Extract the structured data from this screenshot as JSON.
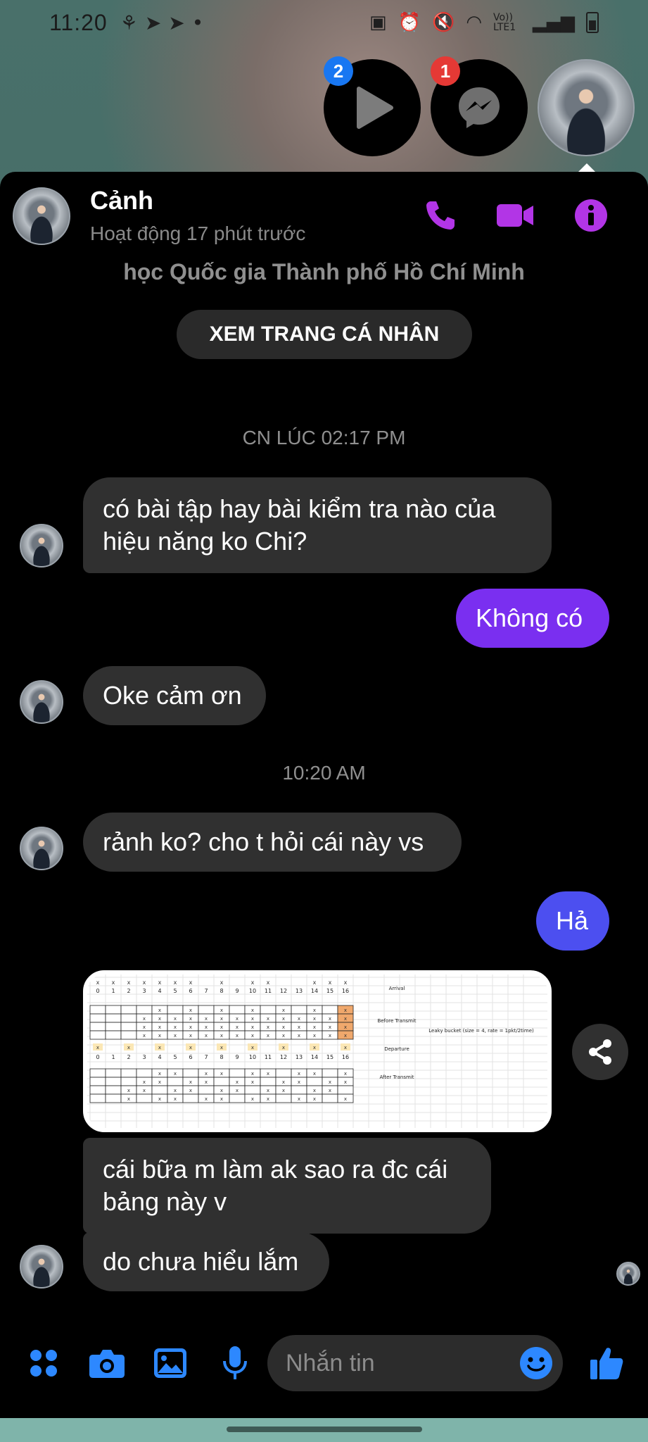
{
  "status_bar": {
    "time": "11:20",
    "network": "Vo)) LTE1",
    "left_icons": [
      "notification-icon",
      "navigation-icon",
      "navigation-icon",
      "dot-icon"
    ],
    "right_icons": [
      "photo-icon",
      "alarm-icon",
      "mute-icon",
      "wifi-icon",
      "signal-icon",
      "battery-icon"
    ]
  },
  "chat_heads": [
    {
      "icon": "play-icon",
      "badge": "2",
      "badge_color": "#1877f2"
    },
    {
      "icon": "messenger-icon",
      "badge": "1",
      "badge_color": "#e53935"
    },
    {
      "icon": "avatar",
      "badge": ""
    }
  ],
  "header": {
    "name": "Cảnh",
    "status": "Hoạt động 17 phút trước",
    "accent": "#b235e6"
  },
  "profile": {
    "subtitle": "học Quốc gia Thành phố Hồ Chí Minh",
    "button_label": "XEM TRANG CÁ NHÂN"
  },
  "messages": {
    "timestamp_1": "CN LÚC 02:17 PM",
    "m1_line1": "có bài tập hay bài kiểm tra nào của",
    "m1_line2": "hiệu năng ko Chi?",
    "m2": "Không có",
    "m3": "Oke cảm ơn",
    "timestamp_2": "10:20 AM",
    "m4": "rảnh ko? cho t hỏi cái này vs",
    "m5": "Hả",
    "m7_line1": "cái bữa m làm ak sao ra đc cái",
    "m7_line2": "bảng này v",
    "m8": "do chưa hiểu lắm"
  },
  "image_table": {
    "columns": [
      "0",
      "1",
      "2",
      "3",
      "4",
      "5",
      "6",
      "7",
      "8",
      "9",
      "10",
      "11",
      "12",
      "13",
      "14",
      "15",
      "16"
    ],
    "labels": {
      "arrival": "Arrival",
      "before": "Before Transmit",
      "departure": "Departure",
      "after": "After Transmit",
      "note": "Leaky bucket (size = 4, rate = 1pkt/2time)"
    },
    "arrival_marks": [
      1,
      1,
      1,
      1,
      1,
      1,
      1,
      0,
      1,
      0,
      1,
      1,
      0,
      0,
      1,
      1,
      1
    ],
    "departure_marks": [
      1,
      0,
      1,
      0,
      1,
      0,
      1,
      0,
      1,
      0,
      1,
      0,
      1,
      0,
      1,
      0,
      1
    ]
  },
  "composer": {
    "placeholder": "Nhắn tin",
    "icons": [
      "apps-icon",
      "camera-icon",
      "gallery-icon",
      "mic-icon",
      "emoji-icon",
      "like-icon"
    ],
    "icon_color": "#2d88ff"
  },
  "colors": {
    "outgoing_1": "#7a2ff0",
    "outgoing_2": "#4c4ff0",
    "incoming": "#303030"
  }
}
